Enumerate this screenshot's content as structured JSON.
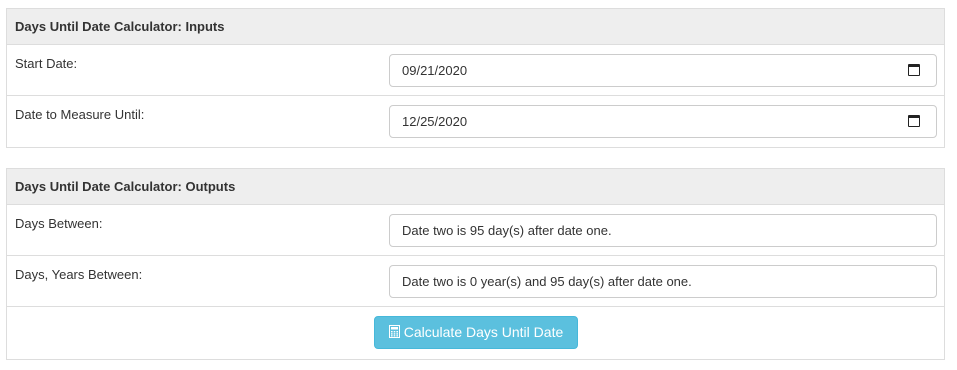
{
  "inputs": {
    "heading": "Days Until Date Calculator: Inputs",
    "start_date_label": "Start Date:",
    "start_date_value": "09/21/2020",
    "end_date_label": "Date to Measure Until:",
    "end_date_value": "12/25/2020"
  },
  "outputs": {
    "heading": "Days Until Date Calculator: Outputs",
    "days_between_label": "Days Between:",
    "days_between_value": "Date two is 95 day(s) after date one.",
    "days_years_label": "Days, Years Between:",
    "days_years_value": "Date two is 0 year(s) and 95 day(s) after date one."
  },
  "button": {
    "label": "Calculate Days Until Date",
    "icon": "calculator-icon"
  },
  "colors": {
    "button_bg": "#5bc0de",
    "heading_bg": "#eeeeee",
    "border": "#dddddd"
  }
}
